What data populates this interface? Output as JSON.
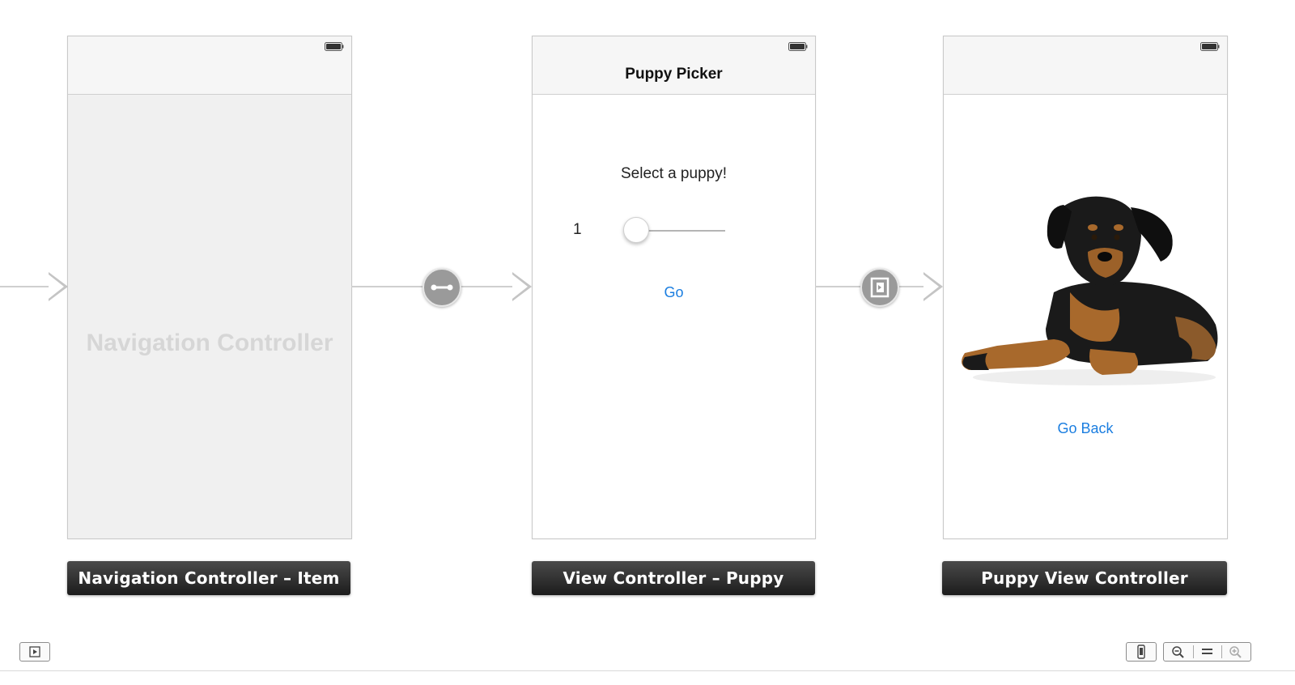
{
  "scenes": {
    "navigation": {
      "placeholder": "Navigation Controller",
      "label": "Navigation Controller – Item"
    },
    "picker": {
      "title": "Puppy Picker",
      "prompt": "Select a puppy!",
      "slider_value": "1",
      "slider_fraction": 0.0,
      "go_label": "Go",
      "label": "View Controller – Puppy Picker"
    },
    "puppy": {
      "back_label": "Go Back",
      "label": "Puppy View Controller"
    }
  },
  "segues": [
    "push-segue-icon",
    "modal-segue-icon"
  ],
  "colors": {
    "link": "#1b7ee0",
    "scene_label_bg": "#2b2b2b",
    "placeholder_text": "#d6d6d6"
  },
  "toolbar": {
    "left": [
      "document-outline-icon"
    ],
    "right": [
      "device-size-icon",
      "zoom-out-icon",
      "actual-size-icon",
      "zoom-in-icon"
    ]
  }
}
